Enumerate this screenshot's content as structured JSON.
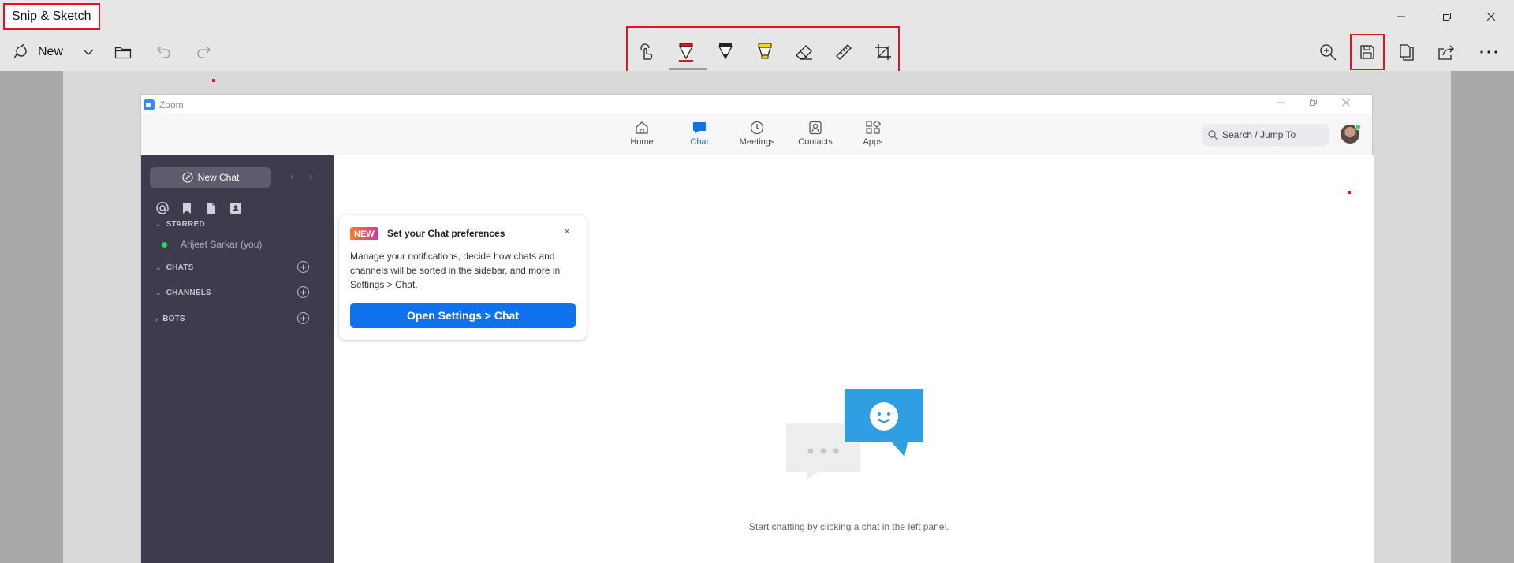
{
  "app": {
    "title": "Snip & Sketch",
    "toolbar": {
      "new_label": "New",
      "left_icons": [
        "new-snip-icon",
        "dropdown-chevron-icon",
        "open-folder-icon",
        "undo-icon",
        "redo-icon"
      ],
      "center_tools": [
        "touch-writing-icon",
        "ballpoint-pen-icon",
        "pencil-icon",
        "highlighter-icon",
        "eraser-icon",
        "ruler-icon",
        "crop-icon"
      ],
      "right_icons": [
        "zoom-in-icon",
        "save-icon",
        "copy-icon",
        "share-icon",
        "more-icon"
      ],
      "window_controls": [
        "minimize-icon",
        "restore-icon",
        "close-icon"
      ]
    }
  },
  "zoom": {
    "window_title": "Zoom",
    "nav": [
      {
        "label": "Home",
        "icon": "home-icon"
      },
      {
        "label": "Chat",
        "icon": "chat-icon"
      },
      {
        "label": "Meetings",
        "icon": "clock-icon"
      },
      {
        "label": "Contacts",
        "icon": "contacts-icon"
      },
      {
        "label": "Apps",
        "icon": "apps-icon"
      }
    ],
    "search_placeholder": "Search / Jump To",
    "sidebar": {
      "new_chat": "New Chat",
      "sections": {
        "starred": "STARRED",
        "chats": "CHATS",
        "channels": "CHANNELS",
        "bots": "BOTS"
      },
      "starred_contact": "Arijeet Sarkar (you)"
    },
    "tooltip": {
      "badge": "NEW",
      "title": "Set your Chat preferences",
      "body": "Manage your notifications, decide how chats and channels will be sorted in the sidebar, and more in Settings > Chat.",
      "button": "Open Settings > Chat"
    },
    "empty_state": "Start chatting by clicking a chat in the left panel."
  },
  "colors": {
    "highlight_red": "#e81123",
    "zoom_blue": "#0e72ed",
    "sidebar_bg": "#3d3c4d"
  }
}
